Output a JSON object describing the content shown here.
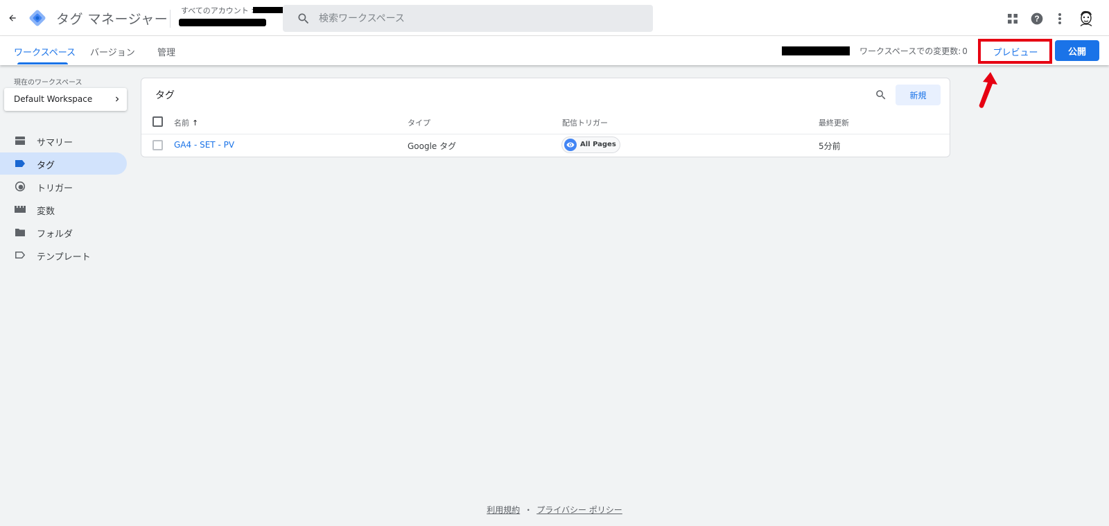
{
  "header": {
    "app_title": "タグ マネージャー",
    "account_breadcrumb": "すべてのアカウント >",
    "search_placeholder": "検索ワークスペース",
    "icons": [
      "back-arrow-icon",
      "gtm-logo-icon",
      "search-icon",
      "apps-grid-icon",
      "help-icon",
      "more-vert-icon",
      "avatar"
    ]
  },
  "tabs": [
    {
      "label": "ワークスペース",
      "active": true
    },
    {
      "label": "バージョン",
      "active": false
    },
    {
      "label": "管理",
      "active": false
    }
  ],
  "workspace_status": {
    "changes_label": "ワークスペースでの変更数:",
    "changes_count": "0"
  },
  "actions": {
    "preview_label": "プレビュー",
    "publish_label": "公開"
  },
  "sidebar": {
    "current_workspace_label": "現在のワークスペース",
    "workspace_name": "Default Workspace",
    "items": [
      {
        "label": "サマリー",
        "icon": "summary-icon",
        "active": false
      },
      {
        "label": "タグ",
        "icon": "tag-icon",
        "active": true
      },
      {
        "label": "トリガー",
        "icon": "trigger-icon",
        "active": false
      },
      {
        "label": "変数",
        "icon": "variables-icon",
        "active": false
      },
      {
        "label": "フォルダ",
        "icon": "folder-icon",
        "active": false
      },
      {
        "label": "テンプレート",
        "icon": "template-icon",
        "active": false
      }
    ]
  },
  "tags_table": {
    "title": "タグ",
    "new_button": "新規",
    "columns": [
      "名前",
      "タイプ",
      "配信トリガー",
      "最終更新"
    ],
    "sort_indicator": "↑",
    "rows": [
      {
        "name": "GA4 - SET - PV",
        "type": "Google タグ",
        "trigger": "All Pages",
        "updated": "5分前"
      }
    ]
  },
  "footer": {
    "terms": "利用規約",
    "separator": "・",
    "privacy": "プライバシー ポリシー"
  },
  "colors": {
    "accent": "#1a73e8",
    "active_nav_bg": "#d2e3fc",
    "annotation_red": "#e60012",
    "background": "#f1f3f4"
  }
}
